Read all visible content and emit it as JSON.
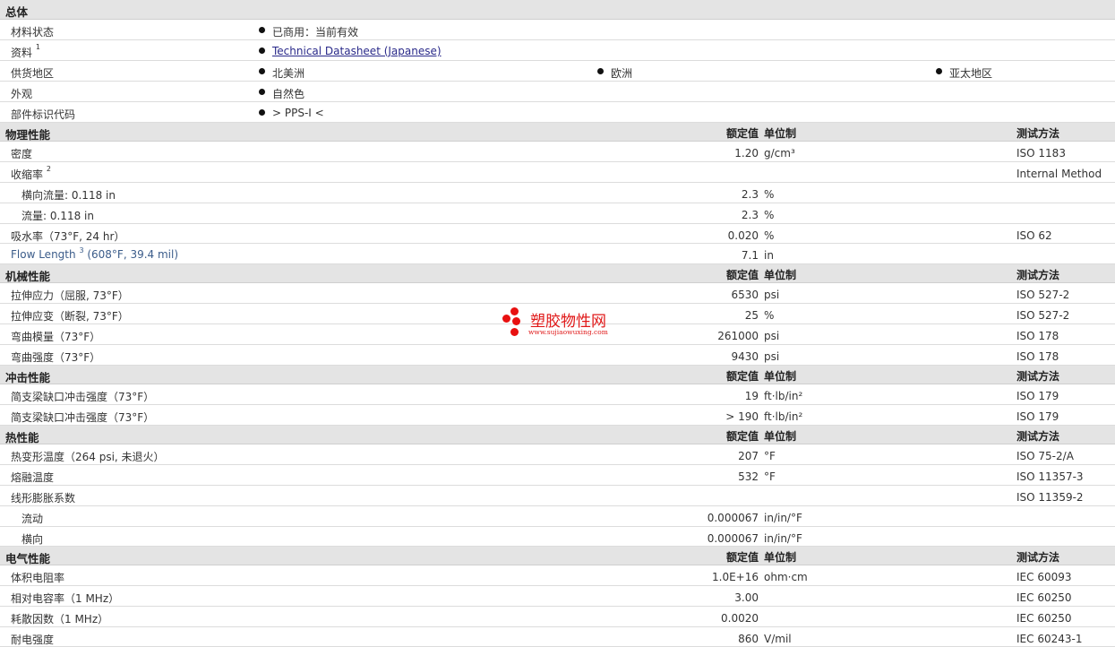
{
  "general": {
    "title": "总体",
    "rows": [
      {
        "label": "材料状态",
        "values": [
          "已商用：当前有效"
        ]
      },
      {
        "label": "资料",
        "sup": "1",
        "values": [
          "Technical Datasheet (Japanese)"
        ]
      },
      {
        "label": "供货地区",
        "values": [
          "北美洲",
          "欧洲",
          "亚太地区"
        ]
      },
      {
        "label": "外观",
        "values": [
          "自然色"
        ]
      },
      {
        "label": "部件标识代码",
        "values": [
          "> PPS-I <"
        ]
      }
    ]
  },
  "sections": [
    {
      "title": "物理性能",
      "h1": "额定值",
      "h2": "单位制",
      "h3": "测试方法",
      "rows": [
        {
          "label": "密度",
          "value": "1.20",
          "unit": "g/cm³",
          "method": "ISO 1183"
        },
        {
          "label": "收缩率",
          "sup": "2",
          "value": "",
          "unit": "",
          "method": "Internal Method"
        },
        {
          "label": "横向流量: 0.118 in",
          "sub": true,
          "value": "2.3",
          "unit": "%",
          "method": ""
        },
        {
          "label": "流量: 0.118 in",
          "sub": true,
          "value": "2.3",
          "unit": "%",
          "method": ""
        },
        {
          "label": "吸水率（73°F, 24 hr）",
          "value": "0.020",
          "unit": "%",
          "method": "ISO 62"
        },
        {
          "label": "Flow Length",
          "sup": "3",
          "label_tail": " (608°F, 39.4 mil)",
          "link": true,
          "value": "7.1",
          "unit": "in",
          "method": ""
        }
      ]
    },
    {
      "title": "机械性能",
      "h1": "额定值",
      "h2": "单位制",
      "h3": "测试方法",
      "rows": [
        {
          "label": "拉伸应力（屈服, 73°F）",
          "value": "6530",
          "unit": "psi",
          "method": "ISO 527-2"
        },
        {
          "label": "拉伸应变（断裂, 73°F）",
          "value": "25",
          "unit": "%",
          "method": "ISO 527-2"
        },
        {
          "label": "弯曲模量（73°F）",
          "value": "261000",
          "unit": "psi",
          "method": "ISO 178"
        },
        {
          "label": "弯曲强度（73°F）",
          "value": "9430",
          "unit": "psi",
          "method": "ISO 178"
        }
      ]
    },
    {
      "title": "冲击性能",
      "h1": "额定值",
      "h2": "单位制",
      "h3": "测试方法",
      "rows": [
        {
          "label": "简支梁缺口冲击强度（73°F）",
          "value": "19",
          "unit": "ft·lb/in²",
          "method": "ISO 179"
        },
        {
          "label": "简支梁缺口冲击强度（73°F）",
          "value": "> 190",
          "unit": "ft·lb/in²",
          "method": "ISO 179"
        }
      ]
    },
    {
      "title": "热性能",
      "h1": "额定值",
      "h2": "单位制",
      "h3": "测试方法",
      "rows": [
        {
          "label": "热变形温度（264 psi, 未退火）",
          "value": "207",
          "unit": "°F",
          "method": "ISO 75-2/A"
        },
        {
          "label": "熔融温度",
          "value": "532",
          "unit": "°F",
          "method": "ISO 11357-3"
        },
        {
          "label": "线形膨胀系数",
          "value": "",
          "unit": "",
          "method": "ISO 11359-2"
        },
        {
          "label": "流动",
          "sub": true,
          "value": "0.000067",
          "unit": "in/in/°F",
          "method": ""
        },
        {
          "label": "横向",
          "sub": true,
          "value": "0.000067",
          "unit": "in/in/°F",
          "method": ""
        }
      ]
    },
    {
      "title": "电气性能",
      "h1": "额定值",
      "h2": "单位制",
      "h3": "测试方法",
      "rows": [
        {
          "label": "体积电阻率",
          "value": "1.0E+16",
          "unit": "ohm·cm",
          "method": "IEC 60093"
        },
        {
          "label": "相对电容率（1 MHz）",
          "value": "3.00",
          "unit": "",
          "method": "IEC 60250"
        },
        {
          "label": "耗散因数（1 MHz）",
          "value": "0.0020",
          "unit": "",
          "method": "IEC 60250"
        },
        {
          "label": "耐电强度",
          "value": "860",
          "unit": "V/mil",
          "method": "IEC 60243-1"
        }
      ]
    }
  ],
  "watermark": {
    "title": "塑胶物性网",
    "url": "www.sujiaowuxing.com"
  }
}
